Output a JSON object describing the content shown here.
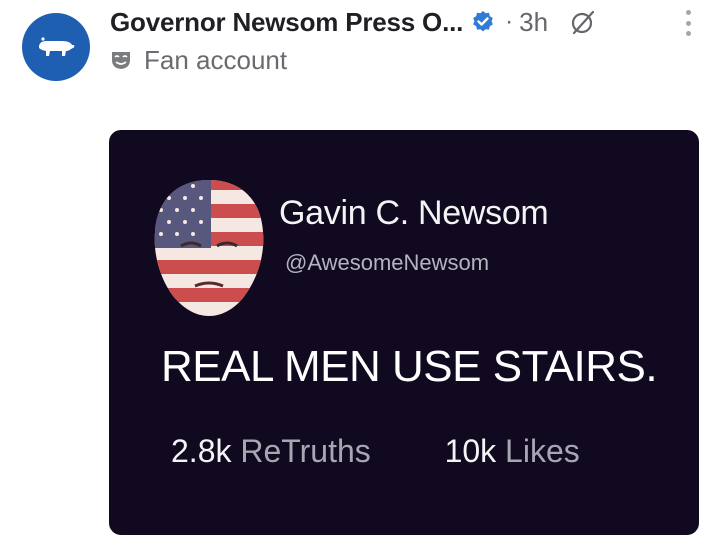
{
  "post": {
    "account_name": "Governor Newsom Press O...",
    "separator": "·",
    "time": "3h",
    "subheader": "Fan account"
  },
  "embedded_post": {
    "display_name": "Gavin C. Newsom",
    "handle": "@AwesomeNewsom",
    "text": "REAL MEN USE STAIRS.",
    "retruths_count": "2.8k",
    "retruths_label": "ReTruths",
    "likes_count": "10k",
    "likes_label": "Likes"
  },
  "icons": {
    "avatar": "bear-logo-icon",
    "verified": "verified-badge-icon",
    "visibility": "globe-strike-icon",
    "menu": "more-vertical-icon",
    "fan": "mask-icon"
  },
  "colors": {
    "avatar_bg": "#1f5fb1",
    "verified": "#2f7bd6",
    "card_bg": "#10091f"
  }
}
